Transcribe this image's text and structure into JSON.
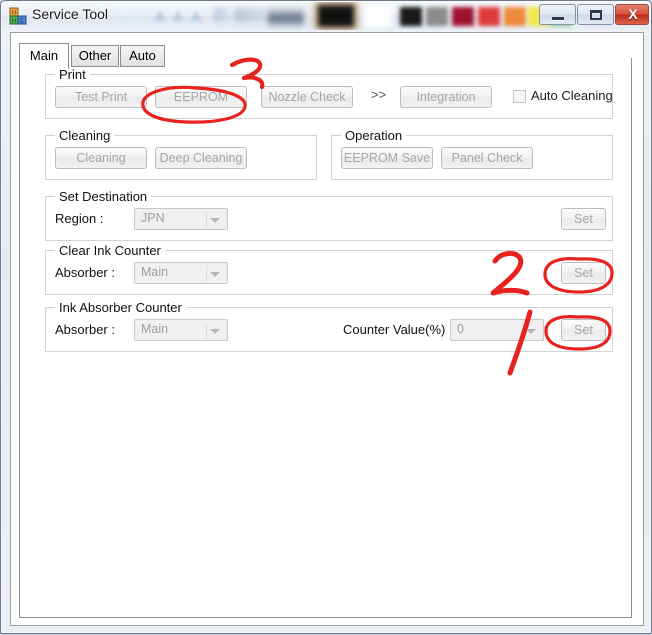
{
  "window": {
    "title": "Service Tool",
    "icon": "toy-blocks-icon",
    "controls": {
      "minimize": "–",
      "maximize": "□",
      "close": "X"
    },
    "swatch_colors": [
      "#1a1a1a",
      "#8c8c8c",
      "#9e1230",
      "#e03b3b",
      "#ef8a3a",
      "#f2e84a",
      "#7fc87f"
    ]
  },
  "tabs": [
    {
      "label": "Main",
      "active": true
    },
    {
      "label": "Other",
      "active": false
    },
    {
      "label": "Auto",
      "active": false
    }
  ],
  "groups": {
    "print": {
      "title": "Print",
      "buttons": [
        "Test Print",
        "EEPROM",
        "Nozzle Check",
        "Integration"
      ],
      "separator": ">>",
      "checkbox": {
        "label": "Auto Cleaning",
        "checked": false
      }
    },
    "cleaning": {
      "title": "Cleaning",
      "buttons": [
        "Cleaning",
        "Deep Cleaning"
      ]
    },
    "operation": {
      "title": "Operation",
      "buttons": [
        "EEPROM Save",
        "Panel Check"
      ]
    },
    "set_destination": {
      "title": "Set Destination",
      "region_label": "Region :",
      "region_value": "JPN",
      "set_label": "Set"
    },
    "clear_ink_counter": {
      "title": "Clear Ink Counter",
      "absorber_label": "Absorber :",
      "absorber_value": "Main",
      "set_label": "Set"
    },
    "ink_absorber_counter": {
      "title": "Ink Absorber Counter",
      "absorber_label": "Absorber :",
      "absorber_value": "Main",
      "counter_label": "Counter Value(%) :",
      "counter_value": "0",
      "set_label": "Set"
    }
  },
  "annotations": {
    "color": "#e8221f",
    "marks": [
      {
        "name": "step-3",
        "text": "3"
      },
      {
        "name": "step-2",
        "text": "2"
      },
      {
        "name": "step-1",
        "text": "1"
      }
    ]
  }
}
